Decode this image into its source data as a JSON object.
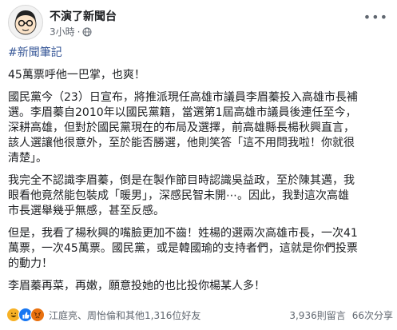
{
  "page": {
    "name": "不演了新聞台",
    "time": "3小時",
    "separator": "·"
  },
  "post": {
    "hashtag": "#新聞筆記",
    "paragraphs": [
      "45萬票呼他一巴掌，也爽！",
      "國民黨今（23）日宣布，將推派現任高雄市議員李眉蓁投入高雄市長補\n選。李眉蓁自2010年以國民黨籍，當選第1屆高雄市議員後連任至今，\n深耕高雄，但對於國民黨現在的布局及選擇，前高雄縣長楊秋興直言，\n該人選讓他很意外，至於能否勝選，他則笑答「這不用問我啦！你就很\n清楚」。",
      "我完全不認識李眉蓁，倒是在製作節目時認識吳益政，至於陳其邁，我\n眼看他竟然能包裝成「暖男」，深感民智未開⋯。因此，我對這次高雄\n市長選舉幾乎無感，甚至反感。",
      "但是，我看了楊秋興的嘴臉更加不齒！姓楊的選兩次高雄市長，一次41\n萬票，一次45萬票。國民黨，或是韓國瑜的支持者們，這就是你們投票\n的動力！",
      "李眉蓁再菜，再嫩，願意投她的也比投你楊某人多！"
    ]
  },
  "engagement": {
    "reactions": [
      "haha-icon",
      "like-icon",
      "angry-icon"
    ],
    "reactors_text": "江庭亮、周怡倫和其他1,316位好友",
    "comments": "3,936則留言",
    "shares": "66次分享"
  },
  "colors": {
    "text": "#1c1e21",
    "meta": "#606770",
    "link": "#385898",
    "like": "#1877f2",
    "haha": "#f7b125",
    "angry": "#e9710f"
  }
}
